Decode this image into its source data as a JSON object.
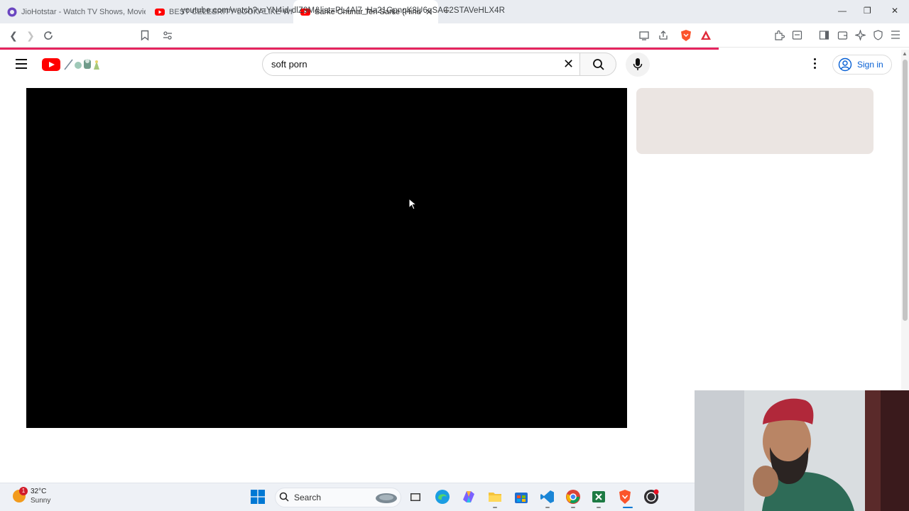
{
  "browser": {
    "tabs": [
      {
        "title": "JioHotstar - Watch TV Shows, Movie",
        "active": false
      },
      {
        "title": "BEST CELEBRITY LOOKALIKE WINS $",
        "active": false
      },
      {
        "title": "Sarke Chunar Teri Sarke (Hindi) |",
        "active": true
      }
    ],
    "url": "youtube.com/watch?v=YN4id-dlZ9M&list=PL4Al7_Ha21GpnqK8U6qSAC2STAVeHLX4R"
  },
  "youtube": {
    "search": {
      "value": "soft porn"
    },
    "signin_label": "Sign in"
  },
  "taskbar": {
    "weather": {
      "temp": "32°C",
      "condition": "Sunny",
      "badge": "1"
    },
    "search_label": "Search"
  },
  "colors": {
    "youtube_red": "#ff0000",
    "link_blue": "#065fd4",
    "load_bar": "#e5245e"
  }
}
